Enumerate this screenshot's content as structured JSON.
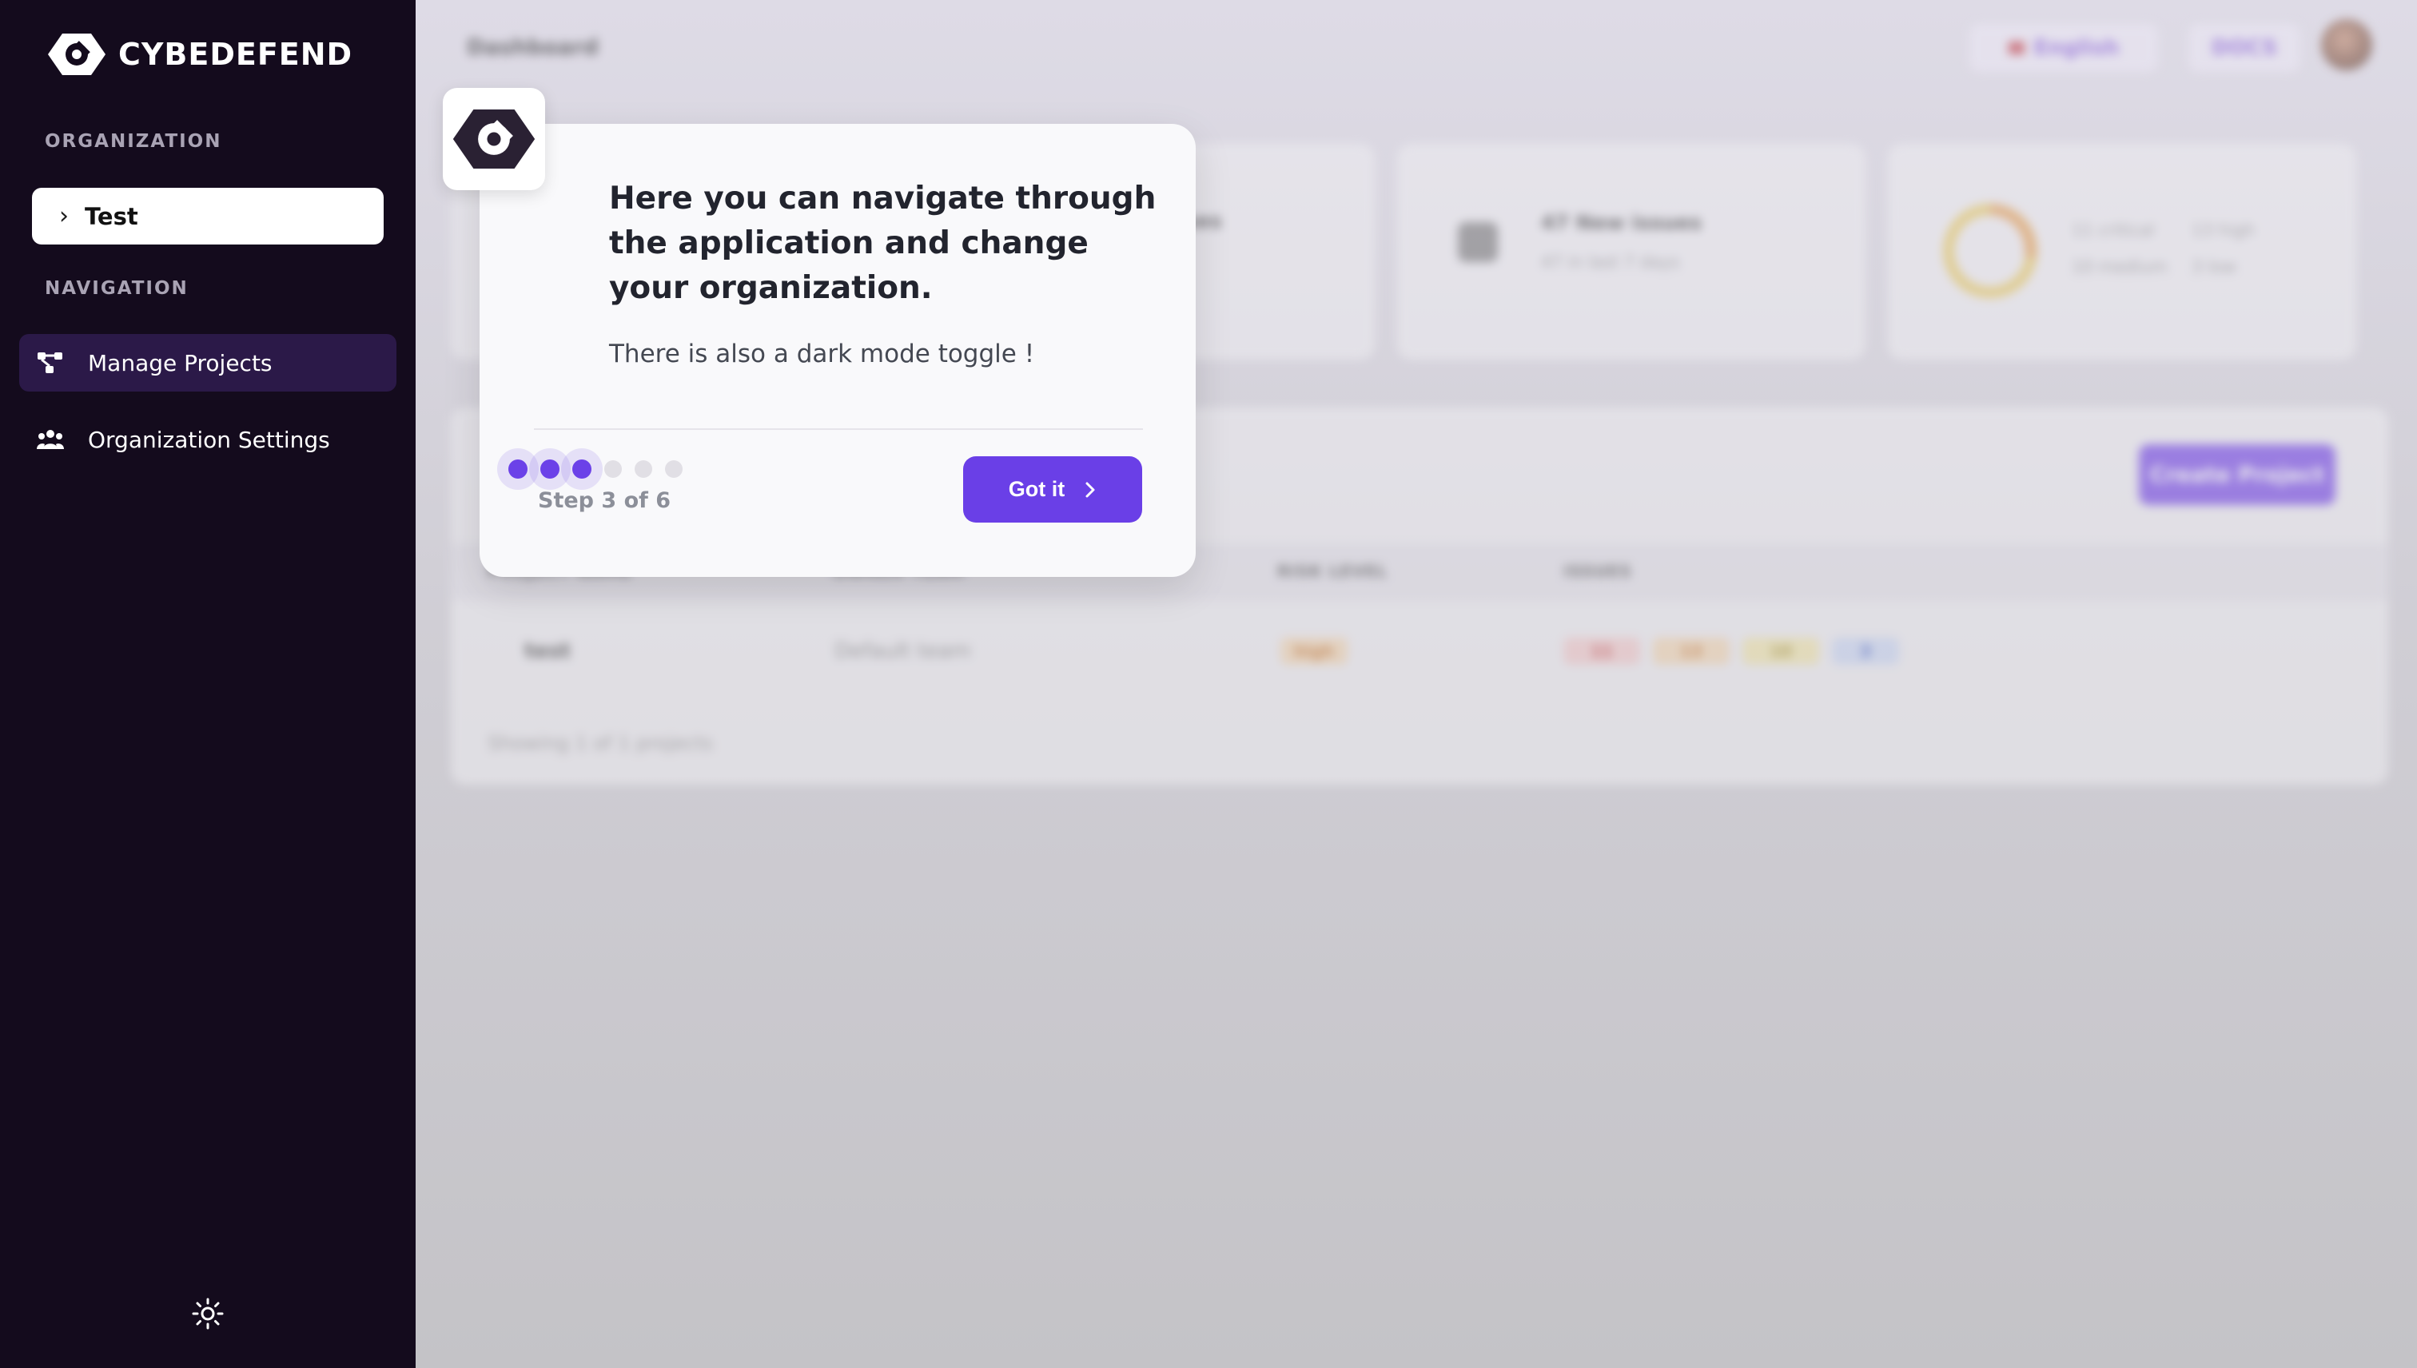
{
  "sidebar": {
    "brand": "CYBEDEFEND",
    "organization_label": "ORGANIZATION",
    "organization_name": "Test",
    "navigation_label": "NAVIGATION",
    "items": [
      {
        "label": "Manage Projects",
        "icon": "project-graph-icon",
        "active": true
      },
      {
        "label": "Organization Settings",
        "icon": "users-icon",
        "active": false
      }
    ],
    "theme_toggle_icon": "sun-icon"
  },
  "background": {
    "page_title": "Dashboard",
    "language": "English",
    "docs": "DOCS",
    "cards": [
      {
        "title": "Issues",
        "subtitle": ""
      },
      {
        "title": "47 New issues",
        "subtitle": "47 in last 7 days"
      },
      {
        "legend": [
          "11 critical",
          "13 high",
          "10 medium",
          "3 low"
        ]
      }
    ],
    "create_project": "Create Project",
    "table_headers": [
      "PROJECT NAME",
      "OWNER TEAM",
      "RISK LEVEL",
      "ISSUES"
    ],
    "row": {
      "name": "test",
      "team": "Default team",
      "risk": "high",
      "issues": [
        "11",
        "13",
        "10",
        "3"
      ]
    },
    "footer": "Showing 1 of 1 projects"
  },
  "tour": {
    "title": "Here you can navigate through the application and change your organization.",
    "text": "There is also a dark mode toggle !",
    "step_text": "Step 3 of 6",
    "current_step": 3,
    "total_steps": 6,
    "button_label": "Got it",
    "accent": "#6a3fe7"
  }
}
